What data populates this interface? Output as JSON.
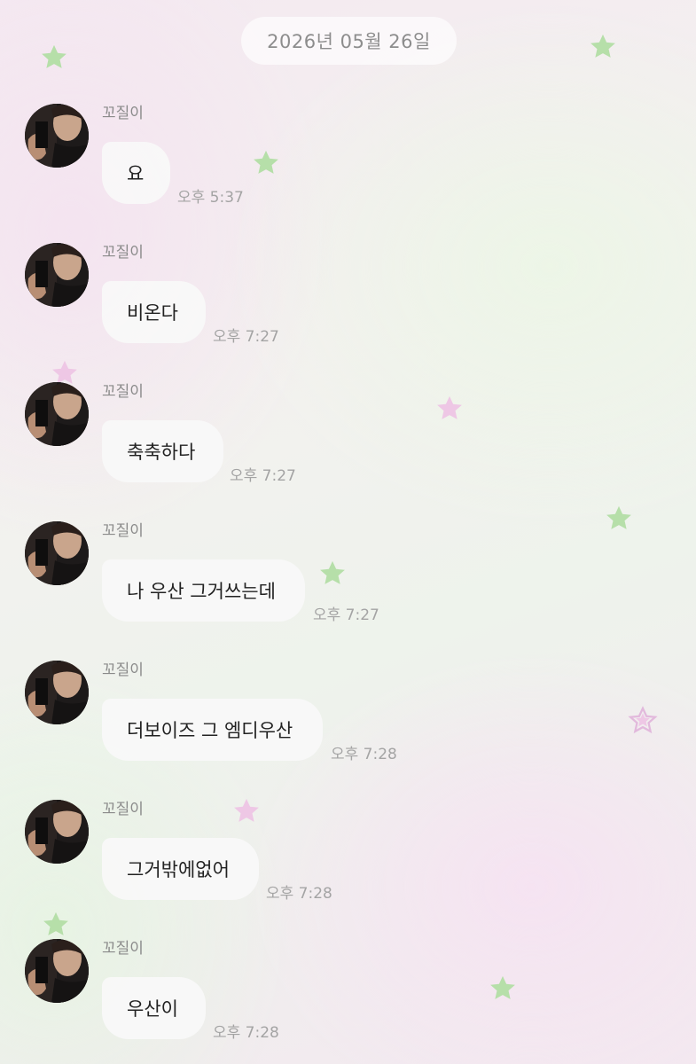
{
  "date_divider": "2026년 05월 26일",
  "messages": [
    {
      "sender": "꼬질이",
      "text": "요",
      "time": "오후 5:37"
    },
    {
      "sender": "꼬질이",
      "text": "비온다",
      "time": "오후 7:27"
    },
    {
      "sender": "꼬질이",
      "text": "축축하다",
      "time": "오후 7:27"
    },
    {
      "sender": "꼬질이",
      "text": "나 우산 그거쓰는데",
      "time": "오후 7:27"
    },
    {
      "sender": "꼬질이",
      "text": "더보이즈 그 엠디우산",
      "time": "오후 7:28"
    },
    {
      "sender": "꼬질이",
      "text": "그거밖에없어",
      "time": "오후 7:28"
    },
    {
      "sender": "꼬질이",
      "text": "우산이",
      "time": "오후 7:28"
    }
  ],
  "colors": {
    "star_green": "#b6dfa9",
    "star_pink": "#eec7e5",
    "bubble": "#f8f8f8",
    "time_text": "#a4a4a4"
  }
}
